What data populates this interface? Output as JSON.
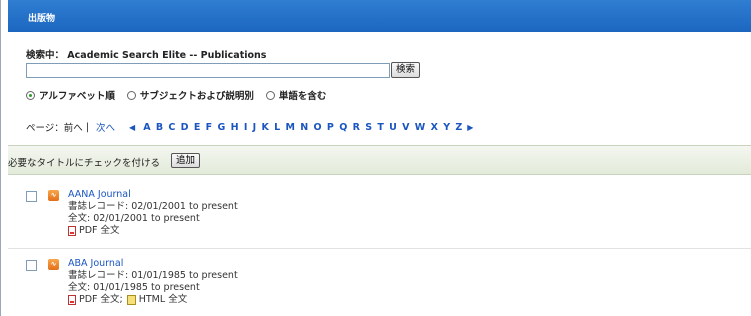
{
  "header": {
    "title": "出版物"
  },
  "search": {
    "label": "検索中： Academic Search Elite -- Publications",
    "value": "",
    "button": "検索"
  },
  "radios": [
    {
      "label": "アルファベット順",
      "checked": true
    },
    {
      "label": "サブジェクトおよび説明別",
      "checked": false
    },
    {
      "label": "単語を含む",
      "checked": false
    }
  ],
  "pager": {
    "prefix": "ページ：前へ",
    "separator": "|",
    "next": "次へ",
    "letters": [
      "A",
      "B",
      "C",
      "D",
      "E",
      "F",
      "G",
      "H",
      "I",
      "J",
      "K",
      "L",
      "M",
      "N",
      "O",
      "P",
      "Q",
      "R",
      "S",
      "T",
      "U",
      "V",
      "W",
      "X",
      "Y",
      "Z"
    ]
  },
  "select_bar": {
    "label": "必要なタイトルにチェックを付ける",
    "add_button": "追加"
  },
  "items": [
    {
      "title": "AANA Journal",
      "record": "書誌レコード: 02/01/2001 to present",
      "fulltext": "全文: 02/01/2001 to present",
      "pdf": "PDF 全文",
      "html": ""
    },
    {
      "title": "ABA Journal",
      "record": "書誌レコード: 01/01/1985 to present",
      "fulltext": "全文: 01/01/1985 to present",
      "pdf": "PDF 全文;",
      "html": "HTML 全文"
    }
  ]
}
